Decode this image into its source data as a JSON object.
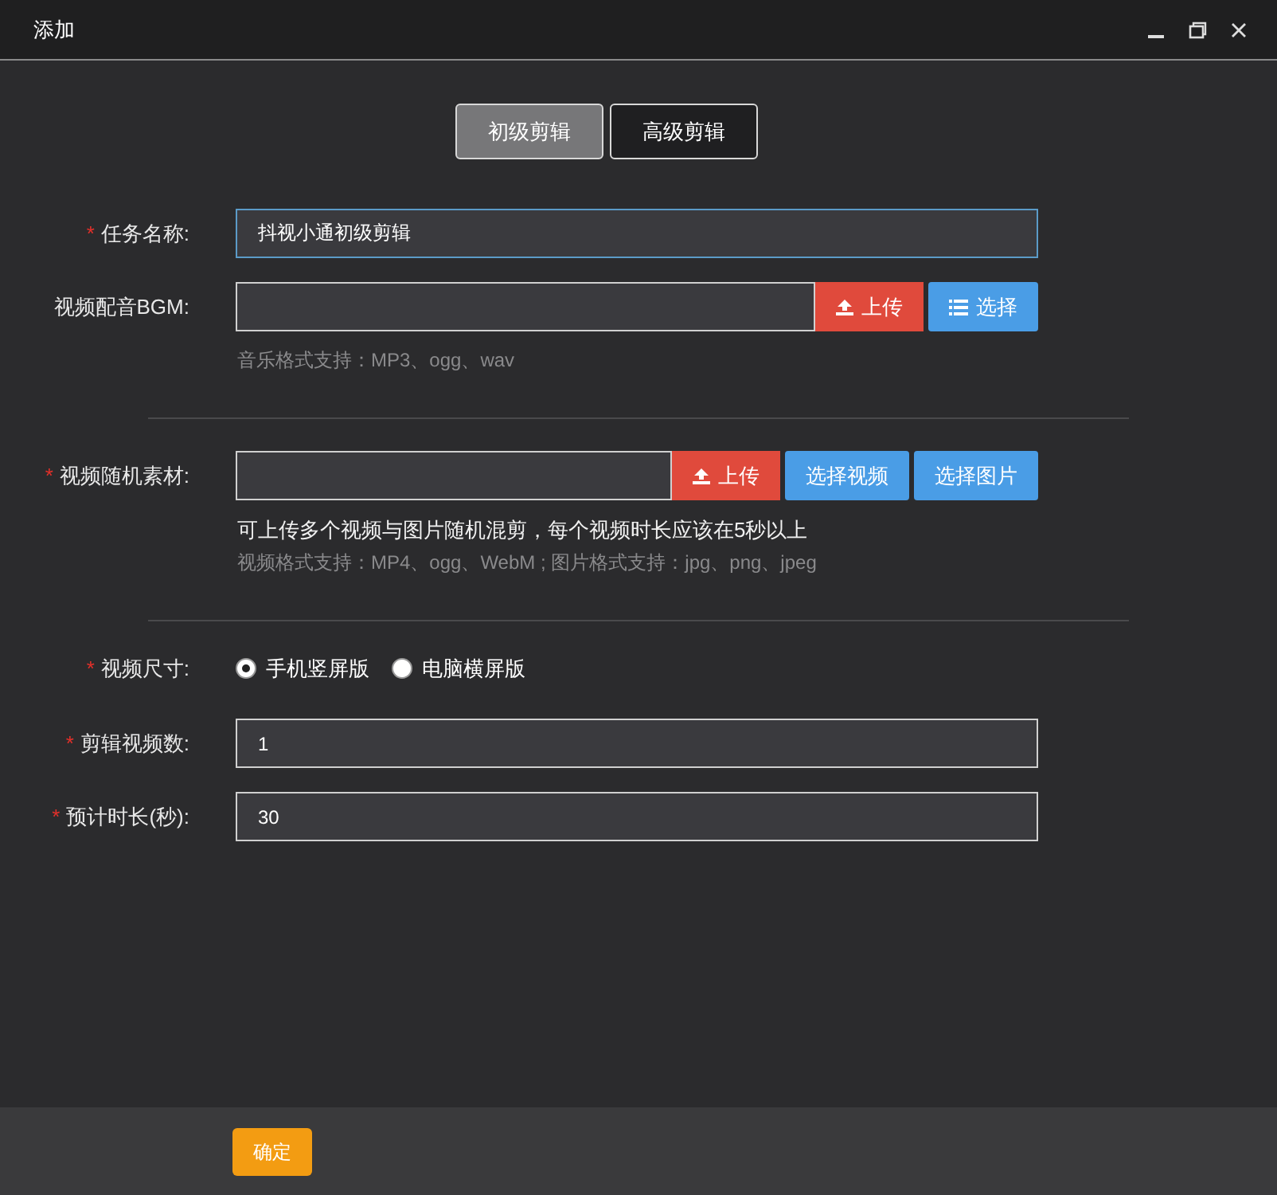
{
  "window": {
    "title": "添加"
  },
  "tabs": [
    {
      "label": "初级剪辑",
      "selected": true
    },
    {
      "label": "高级剪辑",
      "selected": false
    }
  ],
  "sections": [
    {
      "fields": [
        {
          "kind": "text",
          "label": "任务名称:",
          "required_mark": "*",
          "value": "抖视小通初级剪辑",
          "focused": true
        },
        {
          "kind": "file",
          "label": "视频配音BGM:",
          "buttons": [
            {
              "kind": "upload",
              "label": "上传"
            },
            {
              "kind": "list",
              "label": "选择"
            }
          ],
          "notes": [
            {
              "kind": "hint",
              "text": "音乐格式支持：MP3、ogg、wav"
            }
          ]
        }
      ]
    },
    {
      "fields": [
        {
          "kind": "file",
          "label": "视频随机素材:",
          "required_mark": "*",
          "buttons": [
            {
              "kind": "upload",
              "label": "上传"
            },
            {
              "kind": "plain",
              "label": "选择视频"
            },
            {
              "kind": "plain",
              "label": "选择图片"
            }
          ],
          "notes": [
            {
              "kind": "info",
              "text": "可上传多个视频与图片随机混剪，每个视频时长应该在5秒以上"
            },
            {
              "kind": "hint",
              "text": "视频格式支持：MP4、ogg、WebM ; 图片格式支持：jpg、png、jpeg"
            }
          ]
        }
      ]
    },
    {
      "fields": [
        {
          "kind": "radio",
          "label": "视频尺寸:",
          "required_mark": "*",
          "options": [
            {
              "label": "手机竖屏版",
              "selected": true
            },
            {
              "label": "电脑横屏版",
              "selected": false
            }
          ]
        },
        {
          "kind": "text",
          "label": "剪辑视频数:",
          "required_mark": "*",
          "value": "1",
          "focused": false
        },
        {
          "kind": "text",
          "label": "预计时长(秒):",
          "required_mark": "*",
          "value": "30",
          "focused": false
        }
      ]
    }
  ],
  "footer": {
    "confirm_button": "确定"
  }
}
